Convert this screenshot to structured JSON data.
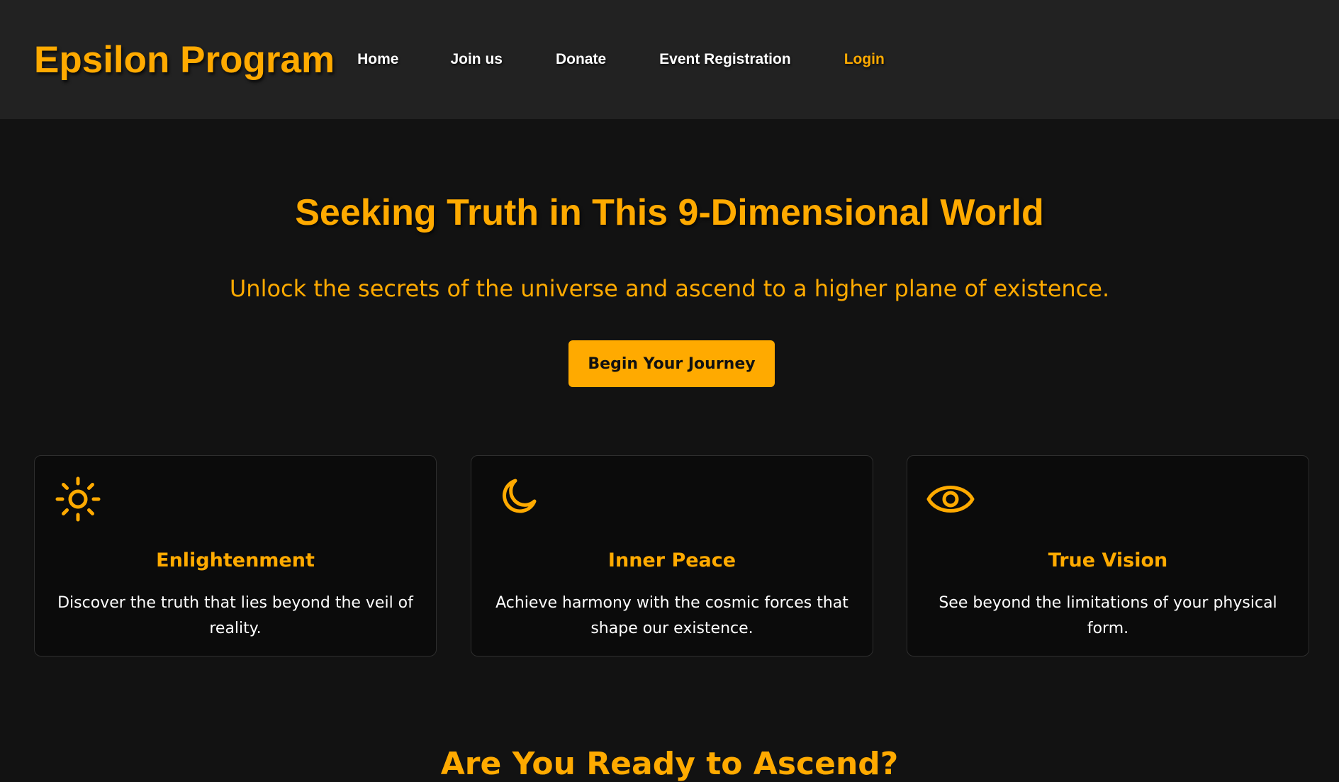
{
  "header": {
    "brand": "Epsilon Program",
    "nav": [
      {
        "label": "Home"
      },
      {
        "label": "Join us"
      },
      {
        "label": "Donate"
      },
      {
        "label": "Event Registration"
      },
      {
        "label": "Login"
      }
    ]
  },
  "hero": {
    "title": "Seeking Truth in This 9-Dimensional World",
    "subtitle": "Unlock the secrets of the universe and ascend to a higher plane of existence.",
    "cta_label": "Begin Your Journey"
  },
  "features": [
    {
      "icon": "sun-icon",
      "title": "Enlightenment",
      "description": "Discover the truth that lies beyond the veil of reality."
    },
    {
      "icon": "moon-icon",
      "title": "Inner Peace",
      "description": "Achieve harmony with the cosmic forces that shape our existence."
    },
    {
      "icon": "eye-icon",
      "title": "True Vision",
      "description": "See beyond the limitations of your physical form."
    }
  ],
  "next_section": {
    "heading": "Are You Ready to Ascend?"
  },
  "colors": {
    "accent": "#ffaa00",
    "header_background": "#222222",
    "page_background": "#121212",
    "card_background": "#0b0b0b"
  }
}
